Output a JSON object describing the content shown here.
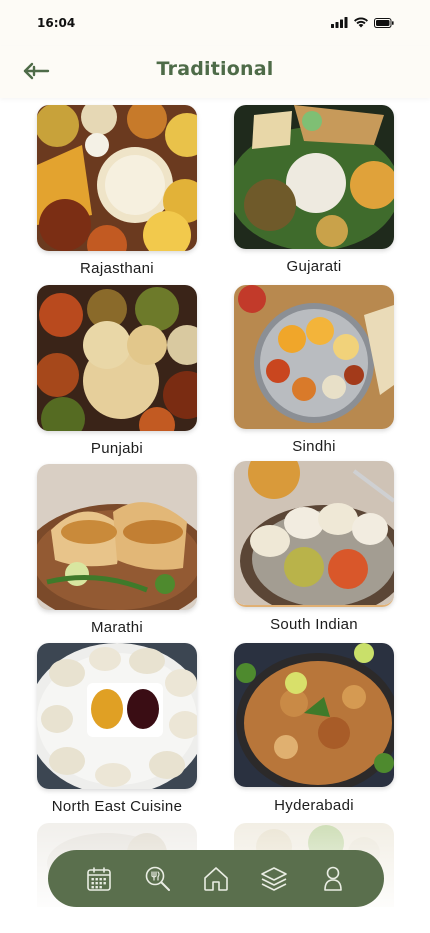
{
  "status_bar": {
    "time": "16:04"
  },
  "header": {
    "title": "Traditional"
  },
  "cuisines": [
    {
      "label": "Rajasthani"
    },
    {
      "label": "Gujarati"
    },
    {
      "label": "Punjabi"
    },
    {
      "label": "Sindhi"
    },
    {
      "label": "Marathi"
    },
    {
      "label": "South Indian"
    },
    {
      "label": "North East Cuisine"
    },
    {
      "label": "Hyderabadi"
    }
  ],
  "bottom_nav": {
    "items": [
      {
        "icon": "calendar-icon"
      },
      {
        "icon": "search-recipe-icon"
      },
      {
        "icon": "home-icon"
      },
      {
        "icon": "layers-icon"
      },
      {
        "icon": "profile-icon"
      }
    ]
  },
  "colors": {
    "accent": "#4e6b48",
    "nav_background": "#5a6f4d",
    "background": "#fdfbf6"
  }
}
